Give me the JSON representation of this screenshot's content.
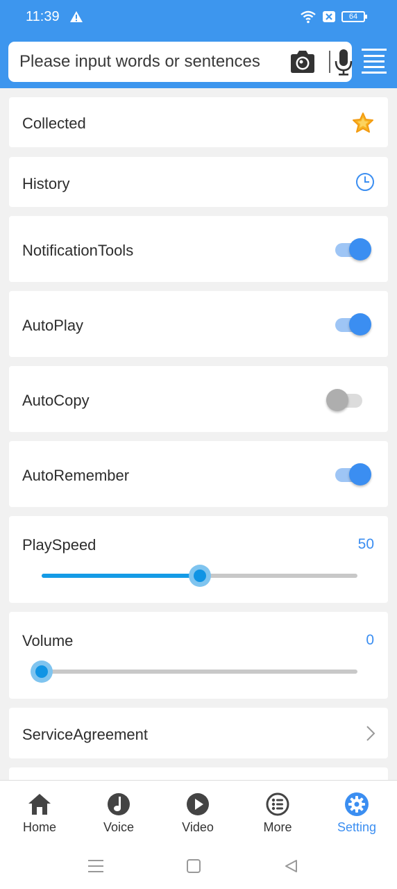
{
  "status_bar": {
    "time": "11:39",
    "battery": "64"
  },
  "search": {
    "placeholder": "Please input words or sentences"
  },
  "settings": {
    "collected": "Collected",
    "history": "History",
    "notification_tools": {
      "label": "NotificationTools",
      "on": true
    },
    "auto_play": {
      "label": "AutoPlay",
      "on": true
    },
    "auto_copy": {
      "label": "AutoCopy",
      "on": false
    },
    "auto_remember": {
      "label": "AutoRemember",
      "on": true
    },
    "play_speed": {
      "label": "PlaySpeed",
      "value": "50",
      "fraction": 0.5
    },
    "volume": {
      "label": "Volume",
      "value": "0",
      "fraction": 0.0
    },
    "service_agreement": "ServiceAgreement"
  },
  "nav": {
    "home": "Home",
    "voice": "Voice",
    "video": "Video",
    "more": "More",
    "setting": "Setting"
  },
  "colors": {
    "accent": "#3b8ef1",
    "header": "#3d96ee",
    "slider": "#149be6"
  }
}
